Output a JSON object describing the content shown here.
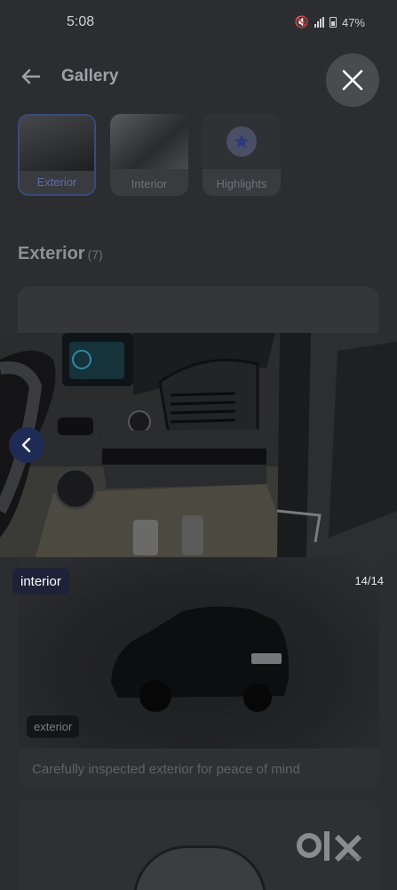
{
  "status_bar": {
    "time": "5:08",
    "battery": "47%"
  },
  "header": {
    "title": "Gallery"
  },
  "tabs": [
    {
      "label": "Exterior",
      "active": true
    },
    {
      "label": "Interior",
      "active": false
    },
    {
      "label": "Highlights",
      "active": false
    }
  ],
  "section": {
    "title": "Exterior",
    "count": "(7)"
  },
  "background_card": {
    "badge": "exterior",
    "caption": "Carefully inspected exterior for peace of mind"
  },
  "viewer": {
    "label": "interior",
    "counter": "14/14"
  },
  "brand": {
    "logo": "OLX",
    "sub": "INDIA"
  },
  "icons": {
    "back": "back-arrow-icon",
    "close": "close-icon",
    "prev": "chevron-left-icon",
    "star": "star-icon"
  },
  "colors": {
    "accent": "#1f2a56",
    "overlay": "#111214"
  }
}
